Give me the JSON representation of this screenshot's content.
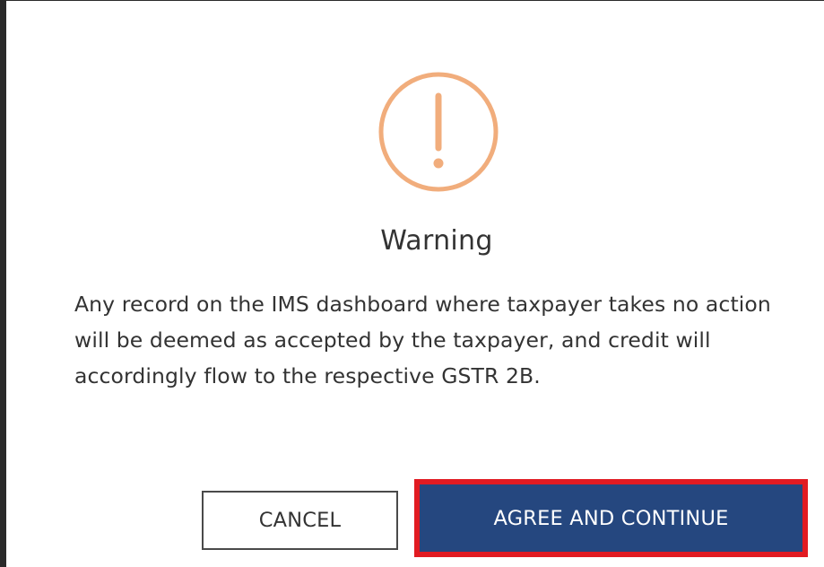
{
  "dialog": {
    "icon": "exclamation-circle-icon",
    "icon_color": "#f1ad7c",
    "title": "Warning",
    "message": "Any record on the IMS dashboard where taxpayer takes no action will be deemed as accepted by the taxpayer, and credit will accordingly flow to the respective GSTR 2B.",
    "buttons": {
      "cancel_label": "CANCEL",
      "agree_label": "AGREE AND CONTINUE"
    },
    "colors": {
      "primary_button": "#25477f",
      "highlight_border": "#e11b22"
    }
  }
}
